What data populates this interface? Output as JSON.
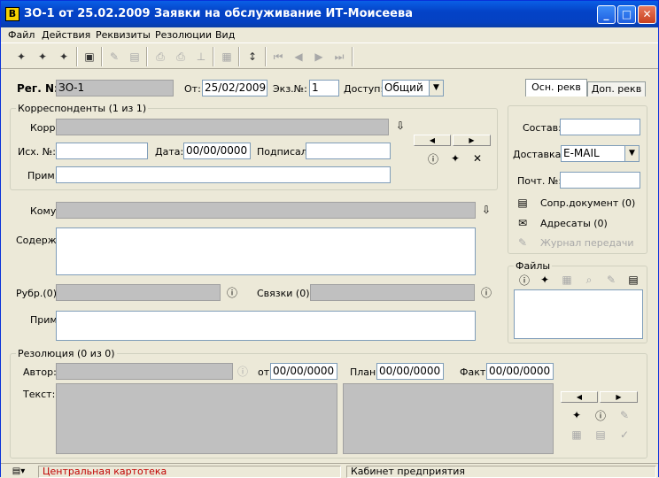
{
  "window": {
    "title": "ЗО-1 от 25.02.2009 Заявки на обслуживание ИТ-Моисеева",
    "icon_text": "В"
  },
  "menu": [
    "Файл",
    "Действия",
    "Реквизиты",
    "Резолюции",
    "Вид"
  ],
  "toolbar_icons": [
    "new-doc-icon",
    "new-doc-copy-icon",
    "new-doc-from-icon",
    "save-icon",
    "edit-icon",
    "delete-icon",
    "print-icon",
    "print-preview-icon",
    "stamp-icon",
    "scan-icon",
    "line-spacing-icon",
    "first-icon",
    "prev-icon",
    "next-icon",
    "last-icon"
  ],
  "header": {
    "reg_label": "Рег. N:",
    "reg_value": "ЗО-1",
    "from_label": "От:",
    "from_value": "25/02/2009",
    "copy_label": "Экз.№:",
    "copy_value": "1",
    "access_label": "Доступ:",
    "access_value": "Общий"
  },
  "tabs": [
    "Осн. рекв",
    "Доп. рекв"
  ],
  "correspondents": {
    "legend": "Корреспонденты (1 из 1)",
    "korr_label": "Корр.:",
    "korr_value": "",
    "out_no_label": "Исх. №:",
    "out_no_value": "",
    "date_label": "Дата:",
    "date_value": "00/00/0000",
    "signed_label": "Подписал:",
    "signed_value": "",
    "note_label": "Прим.:",
    "note_value": ""
  },
  "main": {
    "to_label": "Кому:",
    "to_value": "",
    "content_label": "Содерж.:",
    "content_value": "",
    "rubr_label": "Рубр.(0):",
    "rubr_value": "",
    "links_label": "Связки (0):",
    "links_value": "",
    "note_label": "Прим.:",
    "note_value": ""
  },
  "right_panel": {
    "composition_label": "Состав:",
    "composition_value": "",
    "delivery_label": "Доставка:",
    "delivery_value": "E-MAIL",
    "mail_no_label": "Почт. №:",
    "mail_no_value": "",
    "accompanying_label": "Сопр.документ (0)",
    "addressees_label": "Адресаты (0)",
    "log_label": "Журнал передачи"
  },
  "files": {
    "legend": "Файлы"
  },
  "resolution": {
    "legend": "Резолюция (0 из 0)",
    "author_label": "Автор:",
    "author_value": "",
    "from_label": "от",
    "from_value": "00/00/0000",
    "plan_label": "План:",
    "plan_value": "00/00/0000",
    "fact_label": "Факт:",
    "fact_value": "00/00/0000",
    "text_label": "Текст:"
  },
  "status": {
    "cabinet_left": "Центральная картотека",
    "cabinet_right": "Кабинет предприятия"
  },
  "colors": {
    "title_bar": "#0443c7",
    "status_red": "#c00000",
    "disabled_text": "#a8a8a8"
  }
}
